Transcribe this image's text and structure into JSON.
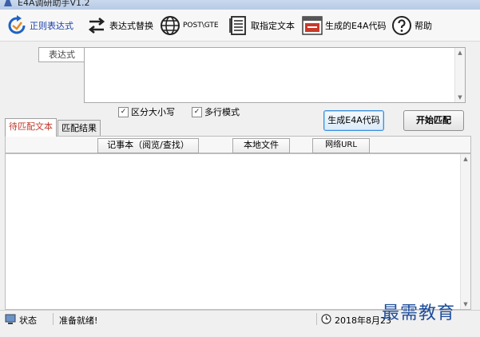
{
  "window": {
    "title": "E4A调研助手V1.2"
  },
  "toolbar": {
    "items": [
      {
        "label": "正则表达式",
        "icon": "regex-refresh-icon"
      },
      {
        "label": "表达式替换",
        "icon": "swap-arrows-icon"
      },
      {
        "label": "POST\\GTE",
        "icon": "globe-icon"
      },
      {
        "label": "取指定文本",
        "icon": "document-lines-icon"
      },
      {
        "label": "生成的E4A代码",
        "icon": "code-window-icon"
      },
      {
        "label": "帮助",
        "icon": "help-circle-icon"
      }
    ]
  },
  "expression": {
    "label": "表达式",
    "value": ""
  },
  "options": {
    "case_sensitive": {
      "label": "区分大小写",
      "checked": true
    },
    "multiline": {
      "label": "多行模式",
      "checked": true
    }
  },
  "buttons": {
    "generate": "生成E4A代码",
    "start": "开始匹配"
  },
  "tabs": [
    {
      "label": "待匹配文本"
    },
    {
      "label": "匹配结果"
    }
  ],
  "source_buttons": {
    "notepad": "记事本（阅览/查找）",
    "local_file": "本地文件",
    "network_url": "网络URL"
  },
  "statusbar": {
    "state_label": "状态",
    "message": "准备就绪!",
    "datetime": "2018年8月23"
  },
  "watermark": "最需教育",
  "colors": {
    "accent_blue": "#1a3fa8",
    "active_tab_text": "#c0392b",
    "generate_border": "#3a8fd8"
  }
}
